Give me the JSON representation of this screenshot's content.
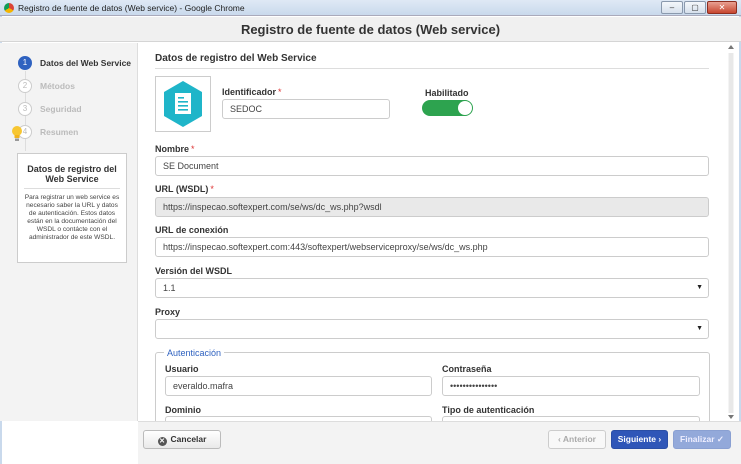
{
  "window": {
    "title": "Registro de fuente de datos (Web service) - Google Chrome"
  },
  "header": {
    "title": "Registro de fuente de datos (Web service)"
  },
  "steps": [
    {
      "num": "1",
      "label": "Datos del Web Service",
      "active": true
    },
    {
      "num": "2",
      "label": "Métodos",
      "active": false
    },
    {
      "num": "3",
      "label": "Seguridad",
      "active": false
    },
    {
      "num": "4",
      "label": "Resumen",
      "active": false
    }
  ],
  "info": {
    "title": "Datos de registro del Web Service",
    "text": "Para registrar un web service es necesario saber la URL y datos de autenticación. Estos datos están en la documentación del WSDL o contácte con el administrador de este WSDL."
  },
  "form": {
    "section_title": "Datos de registro del Web Service",
    "identificador": {
      "label": "Identificador",
      "required": "*",
      "value": "SEDOC"
    },
    "habilitado": {
      "label": "Habilitado",
      "on": true
    },
    "nombre": {
      "label": "Nombre",
      "required": "*",
      "value": "SE Document"
    },
    "url_wsdl": {
      "label": "URL (WSDL)",
      "required": "*",
      "value": "https://inspecao.softexpert.com/se/ws/dc_ws.php?wsdl"
    },
    "url_conexion": {
      "label": "URL de conexión",
      "value": "https://inspecao.softexpert.com:443/softexpert/webserviceproxy/se/ws/dc_ws.php"
    },
    "version": {
      "label": "Versión del WSDL",
      "value": "1.1"
    },
    "proxy": {
      "label": "Proxy",
      "value": ""
    },
    "autenticacion": {
      "legend": "Autenticación",
      "usuario": {
        "label": "Usuario",
        "value": "everaldo.mafra"
      },
      "contrasena": {
        "label": "Contraseña",
        "value": "•••••••••••••••"
      },
      "dominio": {
        "label": "Dominio"
      },
      "tipo": {
        "label": "Tipo de autenticación"
      }
    }
  },
  "footer": {
    "cancel": "Cancelar",
    "prev": "Anterior",
    "next": "Siguiente",
    "finish": "Finalizar"
  },
  "colors": {
    "accent": "#2f56b8",
    "toggle_on": "#2da34f",
    "icon_teal": "#1fb5c9",
    "required": "#d33333"
  }
}
